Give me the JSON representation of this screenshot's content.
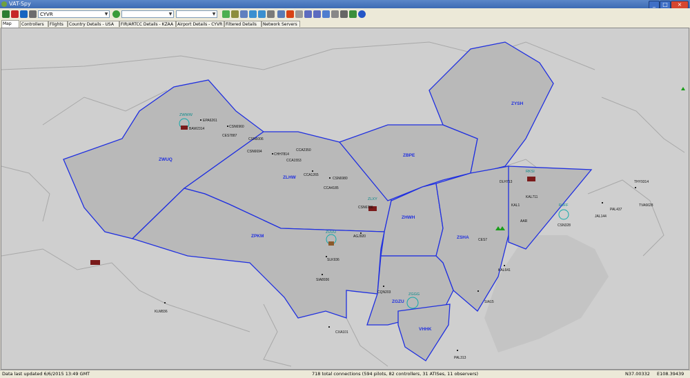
{
  "window": {
    "title": "VAT-Spy",
    "minimize": "_",
    "maximize": "□",
    "close": "×"
  },
  "toolbar": {
    "callsign_value": "CYVR",
    "dropdown2_value": "",
    "dropdown3_value": ""
  },
  "tabs": [
    "Map",
    "Controllers",
    "Flights",
    "Country Details - USA",
    "FIR/ARTCC Details - KZAA",
    "Airport Details - CYVR",
    "Filtered Details",
    "Network Servers"
  ],
  "status": {
    "updated": "Data last updated 6/6/2015 13:49 GMT",
    "connections": "718 total connections (594 pilots, 82 controllers, 31 ATISes, 11 observers)",
    "coord_n": "N37.00332",
    "coord_e": "E108.39439"
  },
  "sectors": [
    "ZWUQ",
    "ZLHW",
    "ZPKM",
    "ZBPE",
    "ZYSH",
    "ZSHA",
    "ZHWH",
    "ZGZU",
    "VHHK"
  ],
  "airports": [
    "ZWWW",
    "ZLXY",
    "ZUUU",
    "ZGGG",
    "RKSI",
    "RJFF"
  ],
  "flights": [
    "EPA6261",
    "CSN6960",
    "BAW2314",
    "CES7887",
    "CSN6006",
    "CSN6694",
    "CHH7814",
    "CCA2350",
    "CCA1553",
    "CCA1265",
    "CSN6980",
    "CCA4185",
    "CSN6786",
    "AGJ920",
    "SLK936",
    "SIA8936",
    "CQN203",
    "KAL641",
    "DLH713",
    "KAL711",
    "KAL1",
    "AAR",
    "TVA6628",
    "PAL437",
    "JAL144",
    "THY9314",
    "KLM836",
    "CXA101",
    "PAL313",
    "SIA15",
    "CES7",
    "CSN328"
  ]
}
